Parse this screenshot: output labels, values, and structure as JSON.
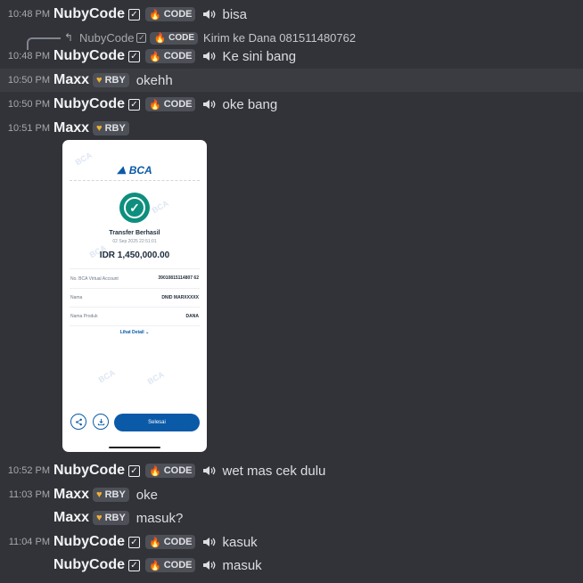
{
  "messages": [
    {
      "time": "10:48 PM",
      "author": "NubyCode",
      "tag": "CODE",
      "text": "bisa"
    },
    {
      "time": "10:48 PM",
      "author": "NubyCode",
      "tag": "CODE",
      "text": "Ke sini bang"
    },
    {
      "time": "10:50 PM",
      "author": "Maxx",
      "tag": "RBY",
      "text": "okehh"
    },
    {
      "time": "10:50 PM",
      "author": "NubyCode",
      "tag": "CODE",
      "text": "oke bang"
    },
    {
      "time": "10:51 PM",
      "author": "Maxx",
      "tag": "RBY",
      "text": ""
    },
    {
      "time": "10:52 PM",
      "author": "NubyCode",
      "tag": "CODE",
      "text": "wet mas cek dulu"
    },
    {
      "time": "11:03 PM",
      "author": "Maxx",
      "tag": "RBY",
      "text": "oke"
    },
    {
      "time": "",
      "author": "Maxx",
      "tag": "RBY",
      "text": "masuk?"
    },
    {
      "time": "11:04 PM",
      "author": "NubyCode",
      "tag": "CODE",
      "text": "kasuk"
    },
    {
      "time": "",
      "author": "NubyCode",
      "tag": "CODE",
      "text": "masuk"
    }
  ],
  "reply": {
    "author": "NubyCode",
    "tag": "CODE",
    "text": "Kirim ke Dana 081511480762"
  },
  "receipt": {
    "brand": "BCA",
    "watermark": "BCA",
    "title": "Transfer Berhasil",
    "datetime": "02 Sep 2025 22:51:01",
    "amount": "IDR 1,450,000.00",
    "rows": [
      {
        "label": "No. BCA Virtual Account",
        "value": "39010815114807 62"
      },
      {
        "label": "Nama",
        "value": "DNID MARXXXXX"
      },
      {
        "label": "Nama Produk",
        "value": "DANA"
      }
    ],
    "detail_link": "Lihat Detail",
    "done_button": "Selesai"
  },
  "colors": {
    "background": "#313338",
    "highlight": "#3a3c42",
    "bca_blue": "#0a5aa8",
    "success": "#0e8f7e"
  },
  "icons": {
    "code_tag": "fire-icon",
    "rby_tag": "heart-icon",
    "speaker": "speaker-icon",
    "share": "share-icon",
    "download": "download-icon",
    "reply": "reply-arrow-icon"
  }
}
